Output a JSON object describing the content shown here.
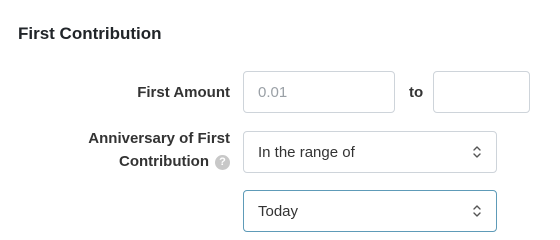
{
  "section": {
    "title": "First Contribution"
  },
  "first_amount": {
    "label": "First Amount",
    "from_placeholder": "0.01",
    "from_value": "",
    "to_label": "to",
    "to_value": ""
  },
  "anniversary": {
    "label_line1": "Anniversary of First",
    "label_line2": "Contribution",
    "help_icon": "question-circle-icon",
    "range_select": {
      "selected": "In the range of"
    },
    "date_select": {
      "selected": "Today"
    }
  },
  "colors": {
    "input_border": "#ced4da",
    "focused_border": "#5e9bb8",
    "help_icon_bg": "#c8c8c8"
  }
}
